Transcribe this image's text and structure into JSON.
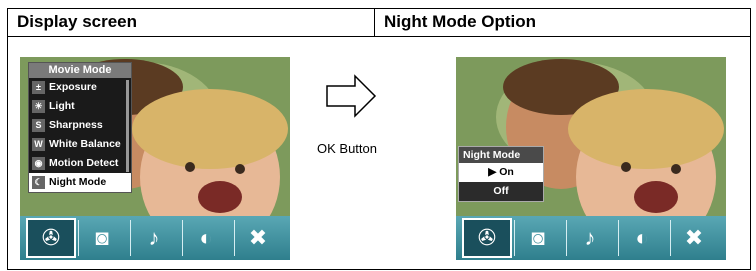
{
  "headers": {
    "display_screen": "Display screen",
    "night_mode_option": "Night Mode Option"
  },
  "ok_label": "OK Button",
  "movie_menu": {
    "title": "Movie Mode",
    "items": [
      {
        "label": "Exposure",
        "icon": "exposure-icon"
      },
      {
        "label": "Light",
        "icon": "light-icon"
      },
      {
        "label": "Sharpness",
        "icon": "sharpness-icon"
      },
      {
        "label": "White Balance",
        "icon": "white-balance-icon"
      },
      {
        "label": "Motion Detect",
        "icon": "motion-detect-icon"
      },
      {
        "label": "Night Mode",
        "icon": "night-mode-icon"
      }
    ],
    "selected": "Night Mode"
  },
  "night_menu": {
    "title": "Night Mode",
    "options": [
      "▶ On",
      "Off"
    ],
    "selected": "▶ On"
  },
  "bottom_tabs": [
    "movie-reel-icon",
    "camera-icon",
    "microphone-icon",
    "palette-icon",
    "tools-icon"
  ]
}
